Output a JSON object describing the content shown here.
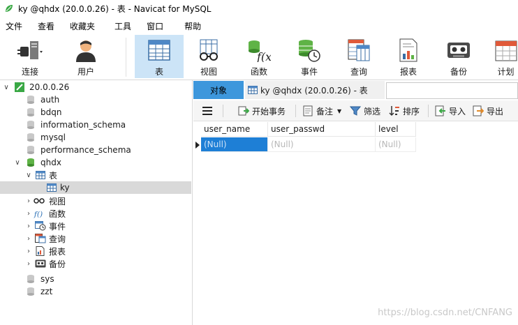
{
  "window": {
    "title": "ky @qhdx (20.0.0.26) - 表 - Navicat for MySQL"
  },
  "menu": [
    "文件",
    "查看",
    "收藏夹",
    "工具",
    "窗口",
    "帮助"
  ],
  "toolbar": [
    {
      "label": "连接",
      "icon": "plug-icon"
    },
    {
      "label": "用户",
      "icon": "user-icon"
    },
    {
      "label": "表",
      "icon": "table-icon",
      "active": true
    },
    {
      "label": "视图",
      "icon": "view-icon"
    },
    {
      "label": "函数",
      "icon": "function-icon"
    },
    {
      "label": "事件",
      "icon": "event-icon"
    },
    {
      "label": "查询",
      "icon": "query-icon"
    },
    {
      "label": "报表",
      "icon": "report-icon"
    },
    {
      "label": "备份",
      "icon": "backup-icon"
    },
    {
      "label": "计划",
      "icon": "schedule-icon"
    }
  ],
  "tree": {
    "connection": "20.0.0.26",
    "databases": [
      "auth",
      "bdqn",
      "information_schema",
      "mysql",
      "performance_schema",
      "qhdx",
      "sys",
      "zzt"
    ],
    "qhdx_children": {
      "tables_label": "表",
      "table_items": [
        "ky"
      ],
      "others": [
        "视图",
        "函数",
        "事件",
        "查询",
        "报表",
        "备份"
      ]
    }
  },
  "tabs": {
    "objects": "对象",
    "active": "ky @qhdx (20.0.0.26) - 表"
  },
  "objbar": {
    "begin_tx": "开始事务",
    "note": "备注",
    "filter": "筛选",
    "sort": "排序",
    "import": "导入",
    "export": "导出"
  },
  "grid": {
    "columns": [
      "user_name",
      "user_passwd",
      "level"
    ],
    "rows": [
      [
        "(Null)",
        "(Null)",
        "(Null)"
      ]
    ]
  },
  "watermark": "https://blog.csdn.net/CNFANG",
  "colors": {
    "tab_active": "#3d97dc",
    "selected_cell": "#1e7fd6",
    "toolbar_active": "#cce4f7"
  }
}
